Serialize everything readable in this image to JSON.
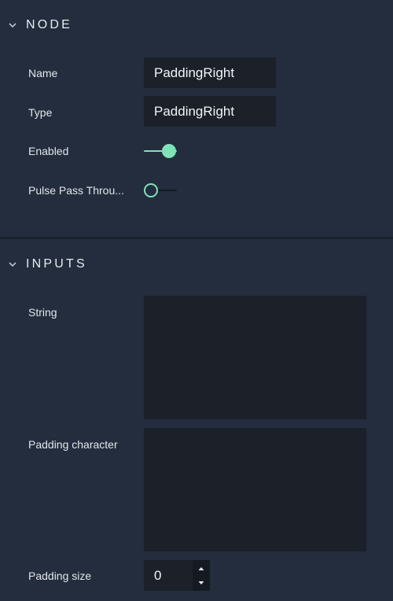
{
  "node_section": {
    "title": "NODE",
    "fields": {
      "name": {
        "label": "Name",
        "value": "PaddingRight"
      },
      "type": {
        "label": "Type",
        "value": "PaddingRight"
      },
      "enabled": {
        "label": "Enabled",
        "state": "on"
      },
      "pulse_pass_through": {
        "label": "Pulse Pass Throu...",
        "state": "off"
      }
    }
  },
  "inputs_section": {
    "title": "INPUTS",
    "fields": {
      "string": {
        "label": "String",
        "value": ""
      },
      "padding_character": {
        "label": "Padding character",
        "value": ""
      },
      "padding_size": {
        "label": "Padding size",
        "value": "0"
      }
    }
  },
  "colors": {
    "background": "#232d3d",
    "field_background": "#1b2029",
    "accent": "#7fe3b8"
  },
  "icons": {
    "section_toggle": "chevron-down-icon",
    "stepper_up": "caret-up-icon",
    "stepper_down": "caret-down-icon"
  }
}
